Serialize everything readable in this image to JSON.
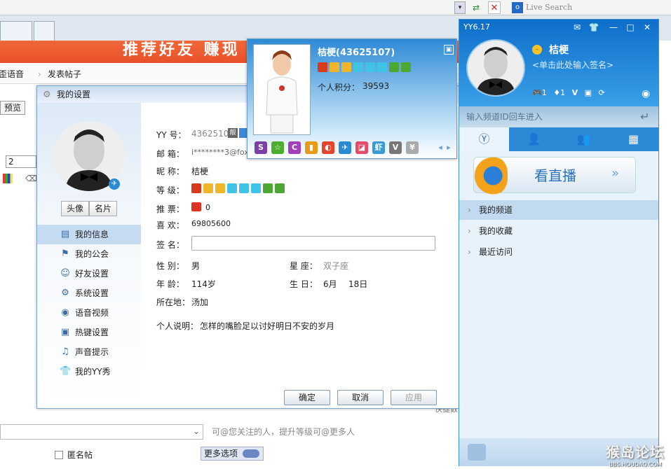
{
  "browser": {
    "search_placeholder": "Live Search"
  },
  "forum": {
    "banner": "推荐好友 赚现",
    "crumb_a": "歪歪语音",
    "crumb_b": "发表帖子",
    "preview": "预览",
    "font_size": "2",
    "mention_hint": "可@您关注的人，提升等级可@更多人",
    "anon": "匿名帖",
    "more_options": "更多选项",
    "partial_text": "快捷数"
  },
  "settings": {
    "title": "我的设置",
    "btn_avatar": "头像",
    "btn_card": "名片",
    "menu": [
      "我的信息",
      "我的公会",
      "好友设置",
      "系统设置",
      "语音视频",
      "热键设置",
      "声音提示",
      "我的YY秀"
    ],
    "labels": {
      "yy": "YY  号：",
      "email": "邮  箱：",
      "nick": "昵  称：",
      "level": "等  级：",
      "votes": "推  票：",
      "likes": "喜  欢：",
      "sign": "签  名：",
      "gender": "性  别：",
      "age": "年  龄：",
      "zodiac": "星  座：",
      "birthday": "生  日：",
      "location": "所在地：",
      "intro": "个人说明："
    },
    "values": {
      "yy": "43625107",
      "email": "i********3@fox",
      "nick": "桔梗",
      "votes": "0",
      "likes": "69805600",
      "gender": "男",
      "age": "114岁",
      "zodiac": "双子座",
      "birth_month": "6月",
      "birth_day": "18日",
      "location": "汤加",
      "intro": "怎样的嘴脸足以讨好明日不安的岁月"
    },
    "buttons": {
      "ok": "确定",
      "cancel": "取消",
      "apply": "应用"
    }
  },
  "card": {
    "name": "桔梗(43625107)",
    "points_label": "个人积分：",
    "points": "39593"
  },
  "yy": {
    "version": "YY6.17",
    "name": "桔梗",
    "sign": "<单击此处输入签名>",
    "badge_a": "1",
    "badge_b": "1",
    "search_placeholder": "输入频道ID回车进入",
    "live": "看直播",
    "items": [
      "我的频道",
      "我的收藏",
      "最近访问"
    ]
  },
  "watermark": {
    "title": "猴岛论坛",
    "url": "BBS.HOUDAO.COM"
  }
}
